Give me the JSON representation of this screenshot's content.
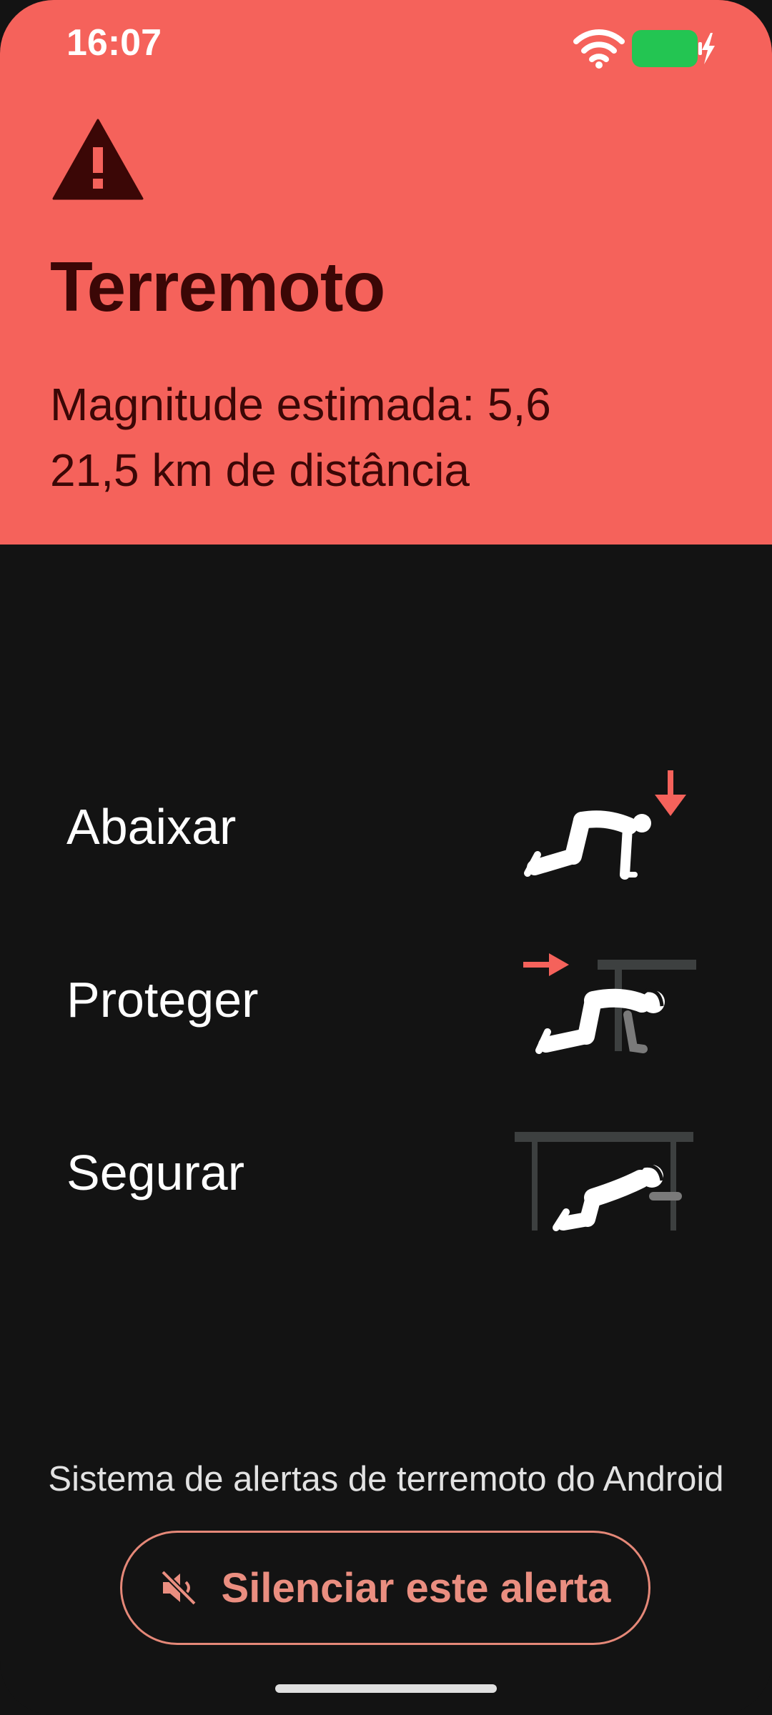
{
  "status_bar": {
    "time": "16:07",
    "battery_color": "#23c552"
  },
  "alert": {
    "title": "Terremoto",
    "magnitude": "Magnitude estimada: 5,6",
    "distance": "21,5 km de distância",
    "header_color": "#f5625b",
    "icon": "warning-icon"
  },
  "steps": [
    {
      "label": "Abaixar",
      "icon": "drop-illustration"
    },
    {
      "label": "Proteger",
      "icon": "cover-illustration"
    },
    {
      "label": "Segurar",
      "icon": "hold-illustration"
    }
  ],
  "footer": {
    "system_name": "Sistema de alertas de terremoto do Android",
    "mute_button_label": "Silenciar este alerta",
    "mute_icon": "volume-off-icon",
    "accent_color": "#ea8e80"
  }
}
